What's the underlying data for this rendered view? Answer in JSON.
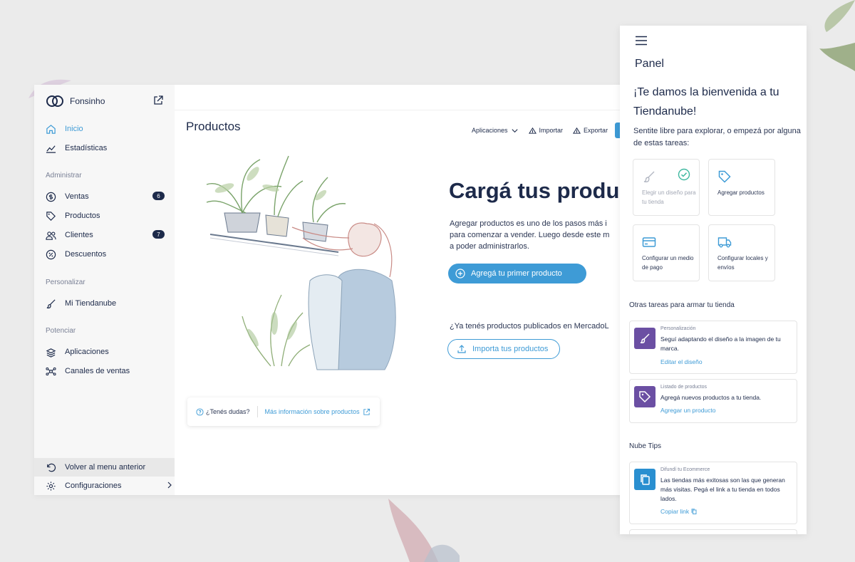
{
  "sidebar": {
    "store_name": "Fonsinho",
    "nav_main": [
      {
        "label": "Inicio",
        "icon": "home-icon"
      },
      {
        "label": "Estadísticas",
        "icon": "chart-icon"
      }
    ],
    "group_administrar": "Administrar",
    "nav_admin": [
      {
        "label": "Ventas",
        "icon": "dollar-icon",
        "badge": "6"
      },
      {
        "label": "Productos",
        "icon": "tag-icon"
      },
      {
        "label": "Clientes",
        "icon": "users-icon",
        "badge": "7"
      },
      {
        "label": "Descuentos",
        "icon": "percent-icon"
      }
    ],
    "group_personalizar": "Personalizar",
    "nav_personalizar": [
      {
        "label": "Mi Tiendanube",
        "icon": "brush-icon"
      }
    ],
    "group_potenciar": "Potenciar",
    "nav_potenciar": [
      {
        "label": "Aplicaciones",
        "icon": "apps-icon"
      },
      {
        "label": "Canales de ventas",
        "icon": "network-icon"
      }
    ],
    "back_label": "Volver al menu anterior",
    "config_label": "Configuraciones"
  },
  "main": {
    "page_title": "Productos",
    "toolbar": {
      "apps_label": "Aplicaciones",
      "import_label": "Importar",
      "export_label": "Exportar"
    },
    "hero_title": "Cargá tus produ",
    "hero_text": [
      "Agregar productos es uno de los pasos más i",
      "para comenzar a vender. Luego desde este m",
      "a poder administrarlos."
    ],
    "primary_button": "Agregá tu primer producto",
    "ml_question": "¿Ya tenés productos publicados en MercadoL",
    "import_button": "Importa tus productos",
    "help_question": "¿Tenés dudas?",
    "help_link": "Más información sobre productos"
  },
  "mobile": {
    "title": "Panel",
    "welcome": "¡Te damos la bienvenida a tu Tiendanube!",
    "subtitle": "Sentite libre para explorar, o empezá por alguna de estas tareas:",
    "tasks": [
      {
        "label": "Elegir un diseño para tu tienda",
        "done": true,
        "icon": "brush-icon"
      },
      {
        "label": "Agregar productos",
        "done": false,
        "icon": "tag-icon"
      },
      {
        "label": "Configurar un medio de pago",
        "done": false,
        "icon": "credit-card-icon"
      },
      {
        "label": "Configurar locales y envíos",
        "done": false,
        "icon": "truck-icon"
      }
    ],
    "other_tasks_title": "Otras tareas para armar tu tienda",
    "other_tasks": [
      {
        "category": "Personalización",
        "text": "Seguí adaptando el diseño a la imagen de tu marca.",
        "link": "Editar el diseño",
        "icon": "brush-icon",
        "color": "#6b4fa3"
      },
      {
        "category": "Listado de productos",
        "text": "Agregá nuevos productos a tu tienda.",
        "link": "Agregar un producto",
        "icon": "tag-icon",
        "color": "#6b4fa3"
      }
    ],
    "tips_title": "Nube Tips",
    "tips": [
      {
        "category": "Difundí tu Ecommerce",
        "text": "Las tiendas más exitosas son las que generan más visitas. Pegá el link a tu tienda en todos lados.",
        "link": "Copiar link",
        "icon": "copy-icon",
        "color": "#2a8fd0"
      }
    ]
  },
  "colors": {
    "accent": "#3e9bd6",
    "navy": "#1d2a4a",
    "purple": "#6b4fa3",
    "success": "#3fb8a0"
  }
}
